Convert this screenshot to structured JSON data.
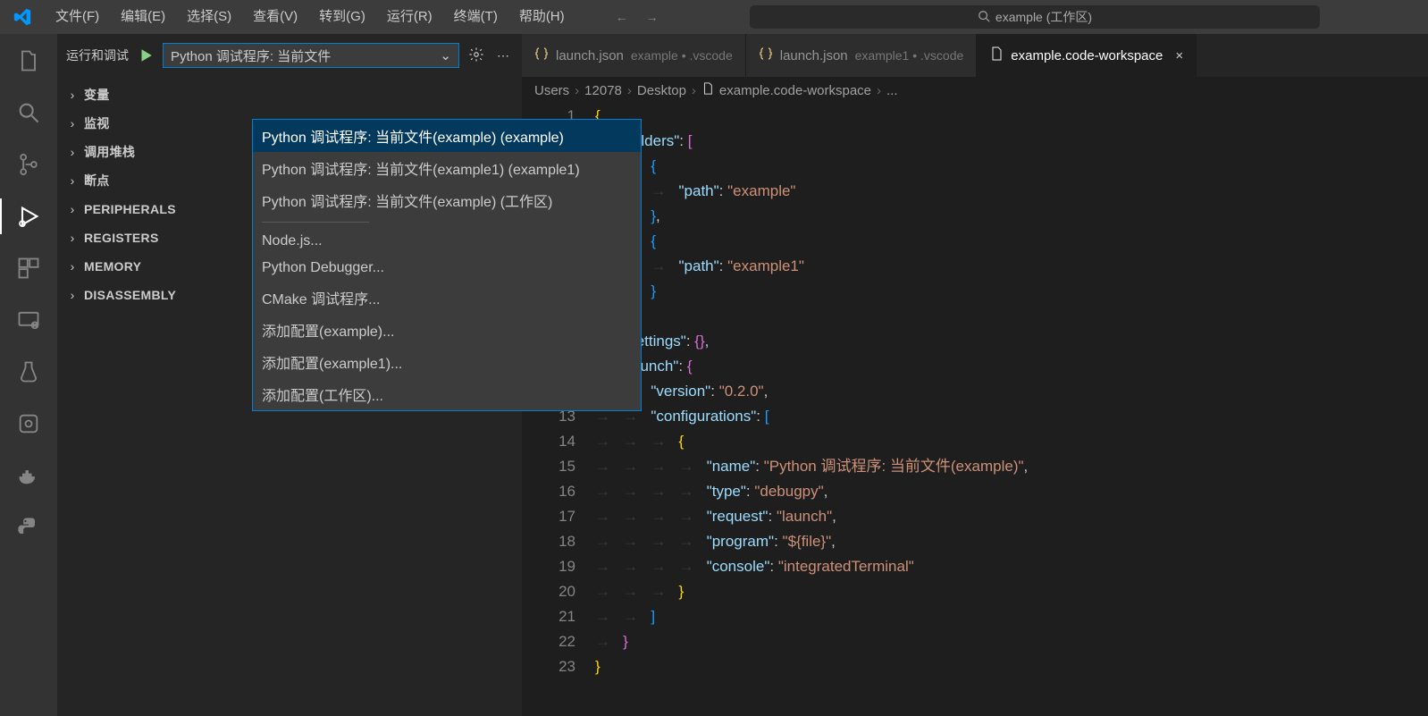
{
  "menubar": {
    "items": [
      "文件(F)",
      "编辑(E)",
      "选择(S)",
      "查看(V)",
      "转到(G)",
      "运行(R)",
      "终端(T)",
      "帮助(H)"
    ]
  },
  "searchbox": {
    "text": "example (工作区)"
  },
  "sidebar": {
    "title": "运行和调试",
    "selected_config": "Python 调试程序: 当前文件",
    "sections": [
      "变量",
      "监视",
      "调用堆栈",
      "断点",
      "PERIPHERALS",
      "REGISTERS",
      "MEMORY",
      "DISASSEMBLY"
    ]
  },
  "dropdown": {
    "group1": [
      "Python 调试程序: 当前文件(example) (example)",
      "Python 调试程序: 当前文件(example1) (example1)",
      "Python 调试程序: 当前文件(example) (工作区)"
    ],
    "group2": [
      "Node.js...",
      "Python Debugger...",
      "CMake 调试程序...",
      "添加配置(example)...",
      "添加配置(example1)...",
      "添加配置(工作区)..."
    ]
  },
  "tabs": [
    {
      "main": "launch.json",
      "sub": "example • .vscode",
      "active": false,
      "close": false
    },
    {
      "main": "launch.json",
      "sub": "example1 • .vscode",
      "active": false,
      "close": false
    },
    {
      "main": "example.code-workspace",
      "sub": "",
      "active": true,
      "close": true
    }
  ],
  "breadcrumb": {
    "parts": [
      "Users",
      "12078",
      "Desktop",
      "example.code-workspace",
      "..."
    ]
  },
  "code": {
    "start_line": 1,
    "raw": "{\n    \"folders\": [\n        {\n            \"path\": \"example\"\n        },\n        {\n            \"path\": \"example1\"\n        }\n    ],\n    \"settings\": {},\n    \"launch\": {\n        \"version\": \"0.2.0\",\n        \"configurations\": [\n            {\n                \"name\": \"Python 调试程序: 当前文件(example)\",\n                \"type\": \"debugpy\",\n                \"request\": \"launch\",\n                \"program\": \"${file}\",\n                \"console\": \"integratedTerminal\"\n            }\n        ]\n    }\n}"
  }
}
